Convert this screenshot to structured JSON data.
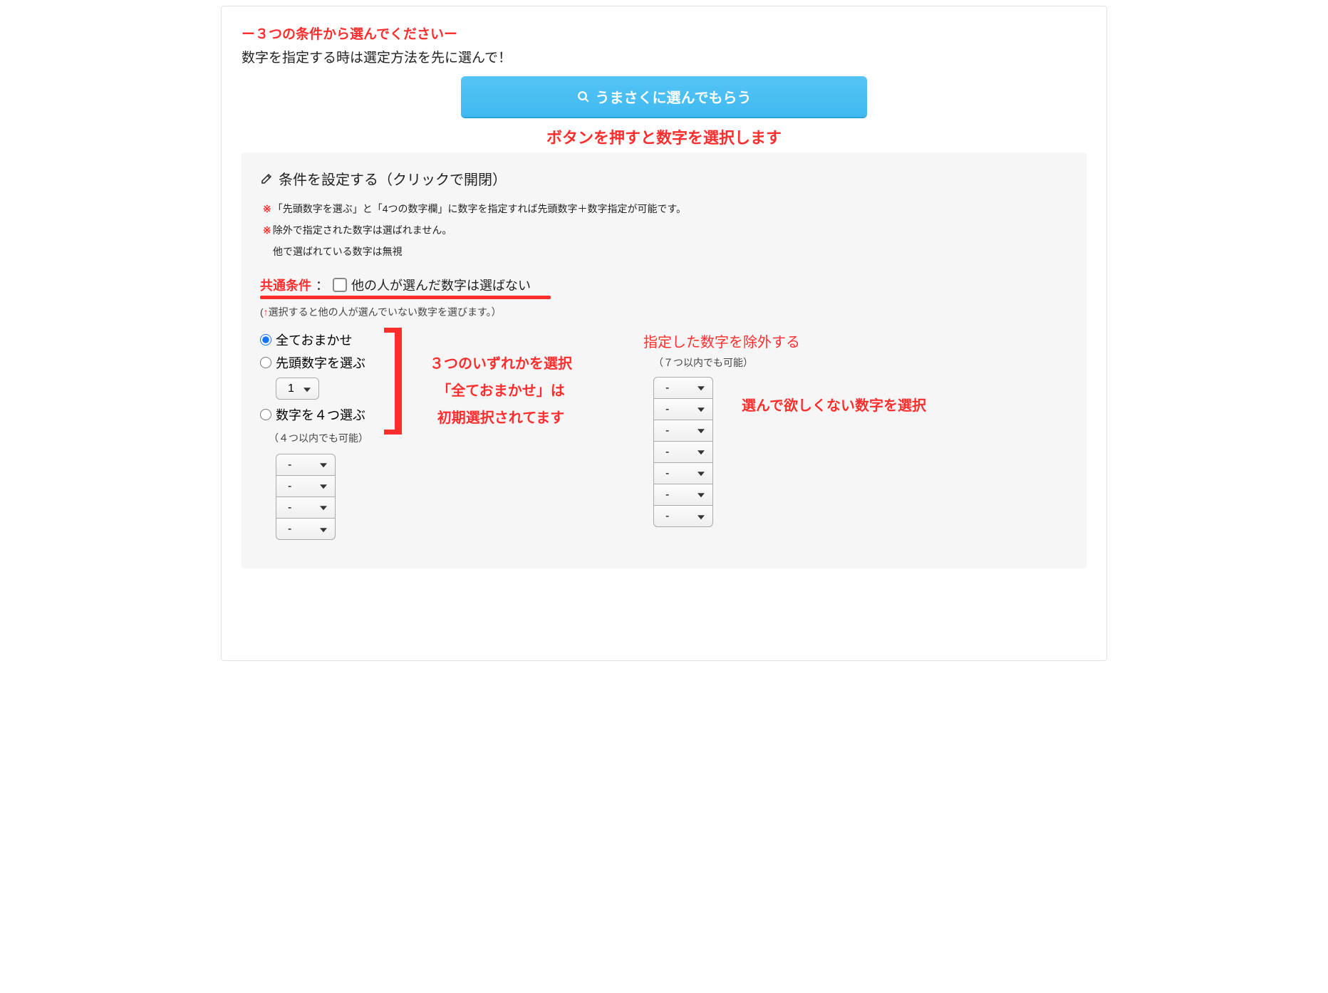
{
  "header": {
    "title": "ー３つの条件から選んでくださいー",
    "subtitle": "数字を指定する時は選定方法を先に選んで！"
  },
  "main_button": {
    "label": "うまさくに選んでもらう"
  },
  "annotations": {
    "top": "ボタンを押すと数字を選択します",
    "mid_line1": "３つのいずれかを選択",
    "mid_line2": "「全ておまかせ」は",
    "mid_line3": "初期選択されてます",
    "right": "選んで欲しくない数字を選択"
  },
  "panel": {
    "header": "条件を設定する（クリックで開閉）",
    "note1": "「先頭数字を選ぶ」と「4つの数字欄」に数字を指定すれば先頭数字＋数字指定が可能です。",
    "note2": "除外で指定された数字は選ばれません。",
    "note3": "他で選ばれている数字は無視"
  },
  "common_condition": {
    "label": "共通条件",
    "colon": "：",
    "text": "他の人が選んだ数字は選ばない",
    "hint_open": "(",
    "hint_arrow": "↑",
    "hint_body": "選択すると他の人が選んでいない数字を選びます。）"
  },
  "radios": {
    "opt1": "全ておまかせ",
    "opt2": "先頭数字を選ぶ",
    "opt3": "数字を４つ選ぶ",
    "lead_value": "1",
    "four_note": "（４つ以内でも可能）",
    "dash": "-"
  },
  "exclude": {
    "title": "指定した数字を除外する",
    "note": "（７つ以内でも可能）",
    "dash": "-"
  }
}
